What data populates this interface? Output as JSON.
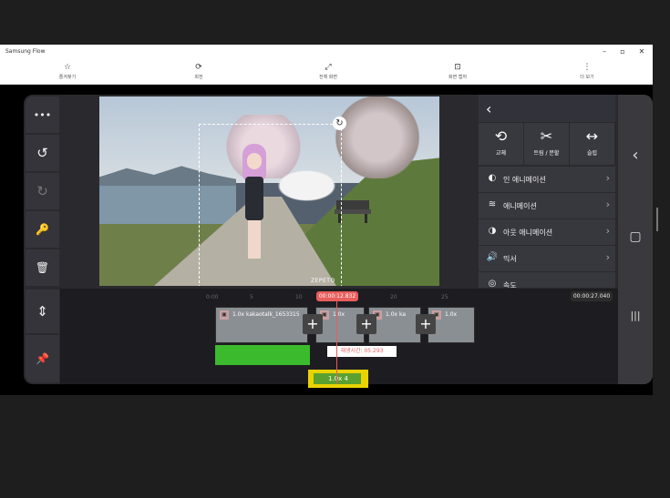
{
  "window": {
    "title": "Samsung Flow",
    "controls": {
      "minimize": "–",
      "maximize": "▫",
      "close": "✕"
    }
  },
  "toolbar": {
    "items": [
      {
        "label": "즐겨찾기",
        "icon": "star-icon",
        "glyph": "☆"
      },
      {
        "label": "회전",
        "icon": "rotate-icon",
        "glyph": "⟳"
      },
      {
        "label": "전체 화면",
        "icon": "fullscreen-icon",
        "glyph": "⤢"
      },
      {
        "label": "화면 캡처",
        "icon": "capture-icon",
        "glyph": "⊡"
      },
      {
        "label": "더 보기",
        "icon": "more-icon",
        "glyph": "⋮"
      }
    ]
  },
  "left_tools": [
    {
      "name": "more",
      "glyph": "•••"
    },
    {
      "name": "undo",
      "glyph": "↺"
    },
    {
      "name": "redo",
      "glyph": "↻"
    },
    {
      "name": "key",
      "glyph": "🔑"
    },
    {
      "name": "delete",
      "glyph": "🗑"
    },
    {
      "name": "align",
      "glyph": "⇕"
    },
    {
      "name": "pin",
      "glyph": "📌"
    }
  ],
  "preview": {
    "watermark": "ZEPETO",
    "rotate_glyph": "↻"
  },
  "panel": {
    "back_glyph": "‹",
    "tools": [
      {
        "label": "교체",
        "glyph": "⟲"
      },
      {
        "label": "트림 / 분할",
        "glyph": "✂"
      },
      {
        "label": "슬립",
        "glyph": "↔"
      }
    ],
    "rows": [
      {
        "label": "인 애니메이션",
        "glyph": "◐"
      },
      {
        "label": "애니메이션",
        "glyph": "≋"
      },
      {
        "label": "아웃 애니메이션",
        "glyph": "◑"
      },
      {
        "label": "믹서",
        "glyph": "🔊"
      },
      {
        "label": "속도",
        "glyph": "◎"
      }
    ],
    "chevron": "›"
  },
  "nav": {
    "back": "‹",
    "home": "▢",
    "recents": "|||"
  },
  "timeline": {
    "ruler_ticks": [
      "0:00",
      "5",
      "10",
      "15",
      "20",
      "25"
    ],
    "current_time": "00:00:12.832",
    "total_time": "00:00:27.040",
    "clips": [
      {
        "label": "1.0x kakaotalk_1653315"
      },
      {
        "label": "1.0x"
      },
      {
        "label": "1.0x ka"
      },
      {
        "label": "1.0x"
      }
    ],
    "add_glyph": "+",
    "tooltip": "재생시간: 05.293",
    "layer_label": "1.0x 4"
  }
}
